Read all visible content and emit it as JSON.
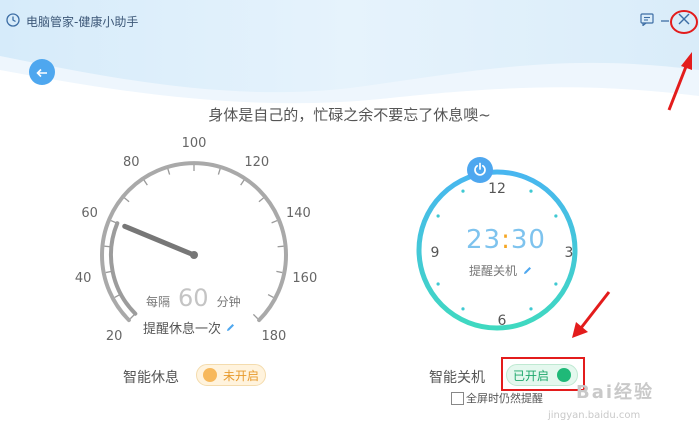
{
  "window": {
    "title": "电脑管家-健康小助手",
    "feedback_icon": "message-icon",
    "minimize_icon": "minimize-icon",
    "close_icon": "close-icon"
  },
  "slogan": "身体是自己的，忙碌之余不要忘了休息噢~",
  "rest_gauge": {
    "ticks": [
      "20",
      "40",
      "60",
      "80",
      "100",
      "120",
      "140",
      "160",
      "180"
    ],
    "interval_prefix": "每隔",
    "interval_value": "60",
    "interval_unit": "分钟",
    "remind_label": "提醒休息一次",
    "edit_icon": "pencil-icon",
    "needle_value": 60
  },
  "shutdown_clock": {
    "numbers": [
      "12",
      "3",
      "6",
      "9"
    ],
    "hour": "23",
    "minute": "30",
    "label": "提醒关机",
    "power_icon": "power-icon"
  },
  "smart_rest": {
    "label": "智能休息",
    "status": "未开启"
  },
  "smart_shutdown": {
    "label": "智能关机",
    "status": "已开启"
  },
  "fullscreen_option": {
    "label": "全屏时仍然提醒"
  },
  "watermark": {
    "brand": "经验",
    "site": "jingyan.baidu.com"
  },
  "colors": {
    "accent_blue": "#4ea7ef",
    "time_blue": "#7ec3ee",
    "toggle_off": "#f7b85b",
    "toggle_on": "#1fb978",
    "annotation_red": "#e31c1c"
  }
}
